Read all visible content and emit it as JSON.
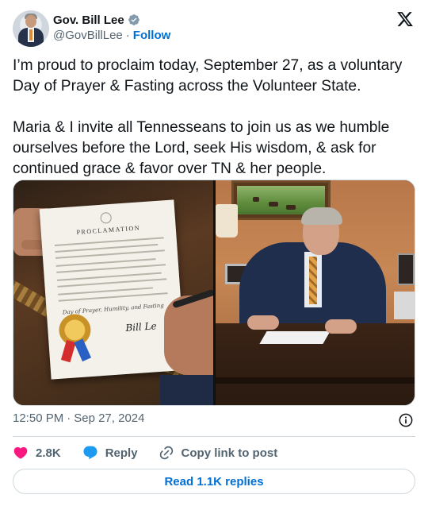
{
  "author": {
    "display_name": "Gov. Bill Lee",
    "handle": "@GovBillLee",
    "separator": "·",
    "follow_label": "Follow",
    "verified": true,
    "verified_color": "#829aab"
  },
  "tweet": {
    "text": "I’m proud to proclaim today, September 27, as a voluntary Day of Prayer & Fasting across the Volunteer State.\n\nMaria & I invite all Tennesseans to join us as we humble ourselves before the Lord, seek His wisdom, & ask for continued grace & favor over TN & her people."
  },
  "media": {
    "left_photo": {
      "document_title": "PROCLAMATION",
      "document_script": "Day of Prayer, Humility, and Fasting",
      "signature": "Bill Le"
    },
    "right_photo": {}
  },
  "meta": {
    "time": "12:50 PM",
    "separator": "·",
    "date": "Sep 27, 2024"
  },
  "actions": {
    "like_count": "2.8K",
    "reply_label": "Reply",
    "copy_label": "Copy link to post",
    "like_color": "#f91880",
    "reply_color": "#1d9bf0"
  },
  "footer": {
    "read_replies_label": "Read 1.1K replies"
  },
  "colors": {
    "link_blue": "#006fd6",
    "muted_text": "#536471",
    "border": "#cfd9de"
  }
}
